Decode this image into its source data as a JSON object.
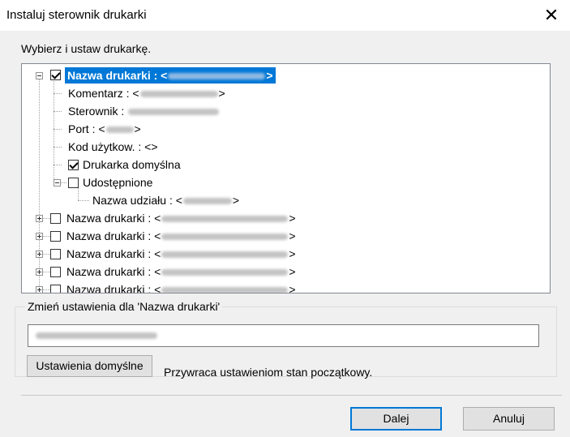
{
  "window": {
    "title": "Instaluj sterownik drukarki",
    "close_glyph": "✕"
  },
  "instruction": "Wybierz  i ustaw drukarkę.",
  "tree": {
    "printer_label": "Nazwa drukarki : <",
    "close_angle": ">",
    "comment_label": "Komentarz : <",
    "driver_label": "Sterownik : ",
    "port_label": "Port : <",
    "user_code_label": "Kod użytkow. : <>",
    "default_printer_label": "Drukarka domyślna",
    "shared_label": "Udostępnione",
    "share_name_label": "Nazwa udziału : <",
    "collapsed_printer_label": "Nazwa drukarki : <"
  },
  "settings_group": {
    "label": "Zmień ustawienia dla 'Nazwa drukarki'"
  },
  "defaults_button": "Ustawienia domyślne",
  "defaults_note": "Przywraca ustawieniom stan początkowy.",
  "next_button": "Dalej",
  "cancel_button": "Anuluj"
}
